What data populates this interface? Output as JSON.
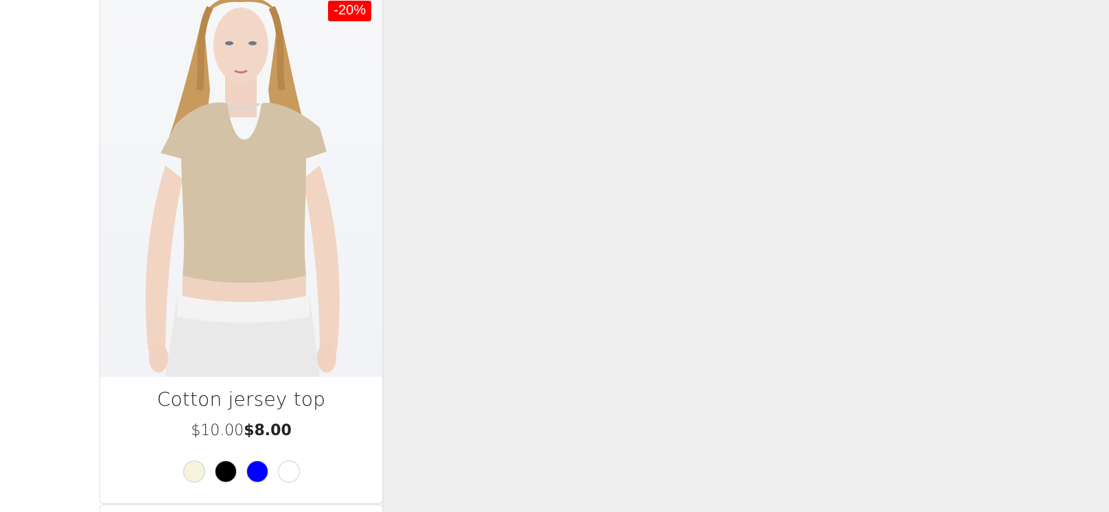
{
  "product": {
    "badge": "-20%",
    "name": "Cotton jersey top",
    "old_price": "$10.00",
    "new_price": "$8.00",
    "swatches": [
      {
        "name": "cream",
        "color": "#f5f3dc"
      },
      {
        "name": "black",
        "color": "#000000"
      },
      {
        "name": "blue",
        "color": "#0000ff"
      },
      {
        "name": "white",
        "color": "#ffffff"
      }
    ]
  },
  "colors": {
    "badge_bg": "#ff0000",
    "page_bg_right": "#eeeeee"
  }
}
